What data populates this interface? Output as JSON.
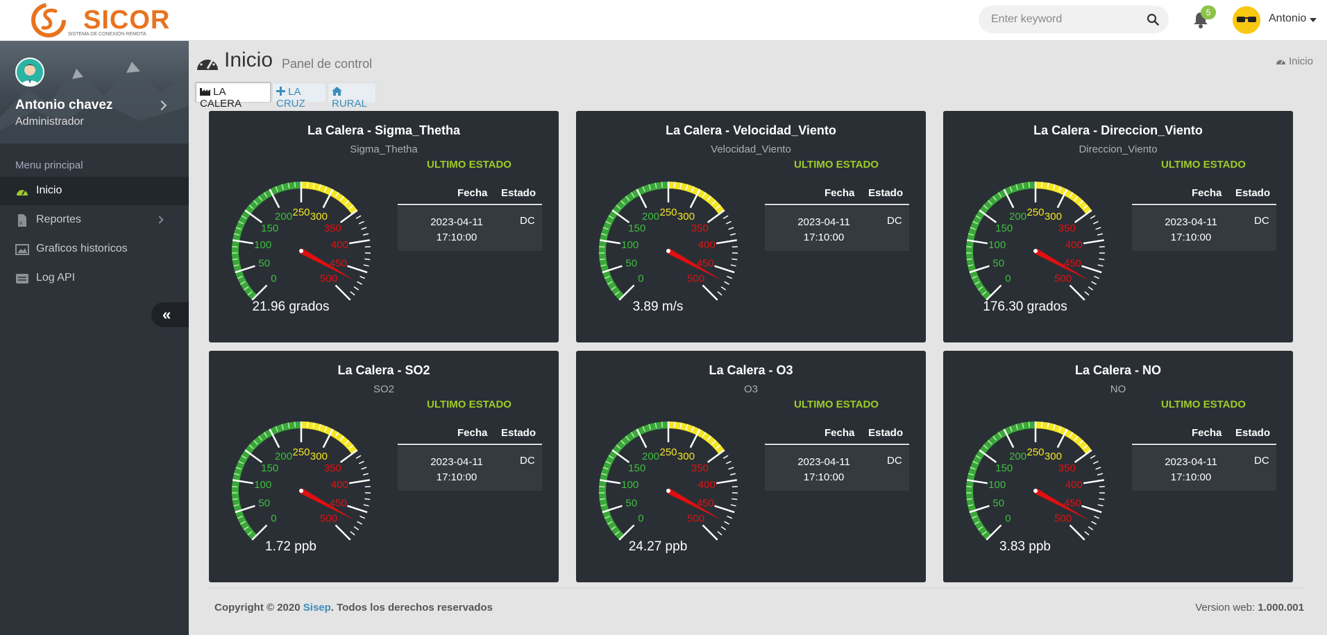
{
  "brand": {
    "logo_text": "SICOR",
    "logo_subtitle": "SISTEMA DE CONEXIÓN REMOTA",
    "accent": "#e8731f"
  },
  "header": {
    "search_placeholder": "Enter keyword",
    "notifications_count": "5",
    "user_name": "Antonio"
  },
  "sidebar": {
    "profile_name": "Antonio chavez",
    "profile_role": "Administrador",
    "menu_heading": "Menu principal",
    "items": [
      {
        "label": "Inicio",
        "icon": "dashboard-icon",
        "active": true
      },
      {
        "label": "Reportes",
        "icon": "excel-file-icon",
        "has_submenu": true
      },
      {
        "label": "Graficos historicos",
        "icon": "image-icon"
      },
      {
        "label": "Log API",
        "icon": "server-icon"
      }
    ],
    "collapse_label": "«"
  },
  "page": {
    "title": "Inicio",
    "subtitle": "Panel de control",
    "breadcrumb": "Inicio"
  },
  "tabs": [
    {
      "label": "LA CALERA",
      "icon": "factory-icon",
      "active": true
    },
    {
      "label": "LA CRUZ",
      "icon": "plus-icon",
      "active": false
    },
    {
      "label": "RURAL",
      "icon": "home-icon",
      "active": false
    }
  ],
  "gauge_scale": {
    "ticks": [
      "0",
      "50",
      "100",
      "150",
      "200",
      "250",
      "300",
      "350",
      "400",
      "450",
      "500"
    ],
    "min": 0,
    "max": 500,
    "zones": {
      "green": [
        0,
        250
      ],
      "yellow": [
        250,
        350
      ],
      "red": [
        350,
        500
      ]
    }
  },
  "cards": [
    {
      "title": "La Calera - Sigma_Thetha",
      "subtitle": "Sigma_Thetha",
      "value_label": "21.96 grados",
      "status_heading": "ULTIMO ESTADO",
      "col_fecha": "Fecha",
      "col_estado": "Estado",
      "fecha": "2023-04-11 17:10:00",
      "estado": "DC"
    },
    {
      "title": "La Calera - Velocidad_Viento",
      "subtitle": "Velocidad_Viento",
      "value_label": "3.89 m/s",
      "status_heading": "ULTIMO ESTADO",
      "col_fecha": "Fecha",
      "col_estado": "Estado",
      "fecha": "2023-04-11 17:10:00",
      "estado": "DC"
    },
    {
      "title": "La Calera - Direccion_Viento",
      "subtitle": "Direccion_Viento",
      "value_label": "176.30 grados",
      "status_heading": "ULTIMO ESTADO",
      "col_fecha": "Fecha",
      "col_estado": "Estado",
      "fecha": "2023-04-11 17:10:00",
      "estado": "DC"
    },
    {
      "title": "La Calera - SO2",
      "subtitle": "SO2",
      "value_label": "1.72 ppb",
      "status_heading": "ULTIMO ESTADO",
      "col_fecha": "Fecha",
      "col_estado": "Estado",
      "fecha": "2023-04-11 17:10:00",
      "estado": "DC"
    },
    {
      "title": "La Calera - O3",
      "subtitle": "O3",
      "value_label": "24.27 ppb",
      "status_heading": "ULTIMO ESTADO",
      "col_fecha": "Fecha",
      "col_estado": "Estado",
      "fecha": "2023-04-11 17:10:00",
      "estado": "DC"
    },
    {
      "title": "La Calera - NO",
      "subtitle": "NO",
      "value_label": "3.83 ppb",
      "status_heading": "ULTIMO ESTADO",
      "col_fecha": "Fecha",
      "col_estado": "Estado",
      "fecha": "2023-04-11 17:10:00",
      "estado": "DC"
    }
  ],
  "footer": {
    "copyright_prefix": "Copyright © 2020",
    "company": "Sisep",
    "rights": ". Todos los derechos reservados",
    "version_label": "Version web:",
    "version": "1.000.001"
  },
  "colors": {
    "sidebar_bg": "#2d3339",
    "card_bg": "#2a2f35",
    "status_green": "#9ccc2a",
    "link_blue": "#3c8dbc",
    "gauge_green": "#3aa83a",
    "gauge_yellow": "#f5e623",
    "gauge_red": "#e01010"
  }
}
